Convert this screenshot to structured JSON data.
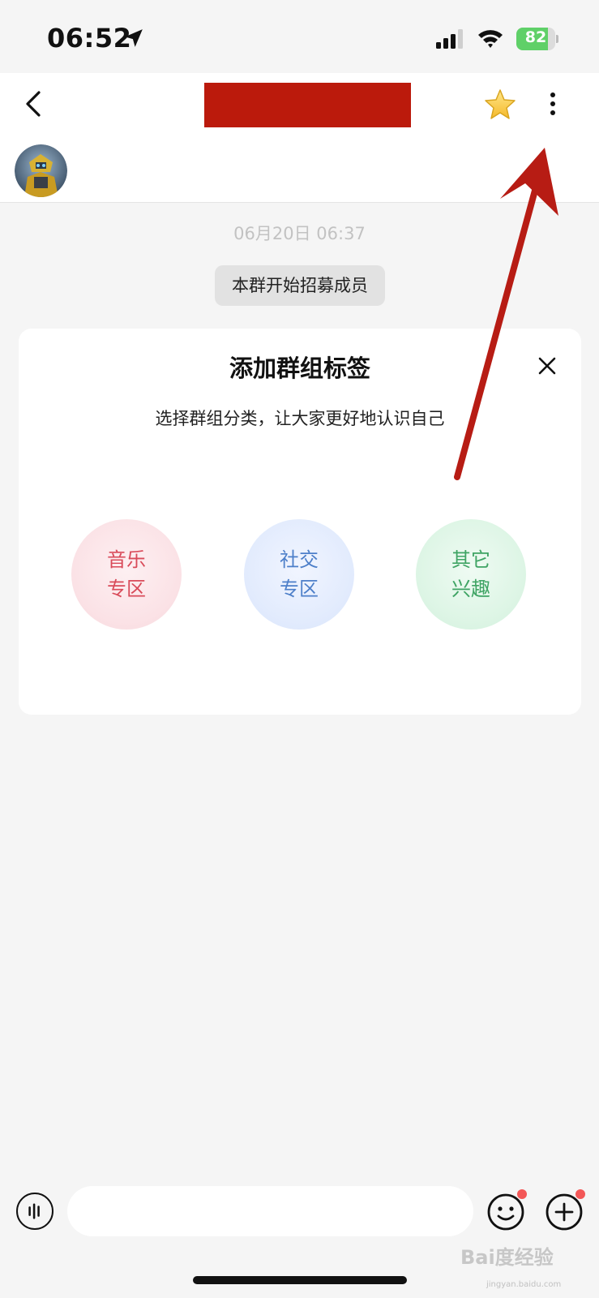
{
  "status_bar": {
    "time": "06:52",
    "battery": "82",
    "battery_level": 0.82
  },
  "chat": {
    "timestamp": "06月20日 06:37",
    "system_message": "本群开始招募成员"
  },
  "tag_card": {
    "title": "添加群组标签",
    "subtitle": "选择群组分类，让大家更好地认识自己",
    "options": [
      {
        "line1": "音乐",
        "line2": "专区"
      },
      {
        "line1": "社交",
        "line2": "专区"
      },
      {
        "line1": "其它",
        "line2": "兴趣"
      }
    ]
  },
  "input": {
    "placeholder": ""
  },
  "watermark": {
    "text": "Bai度经验",
    "sub": "jingyan.baidu.com"
  },
  "colors": {
    "redaction": "#bb1a0c",
    "arrow": "#b71c14",
    "music": "#d94b5a",
    "social": "#4d7fc9",
    "other": "#3fa464"
  },
  "icons": [
    "location-arrow-icon",
    "signal-icon",
    "wifi-icon",
    "back-icon",
    "star-icon",
    "more-vertical-icon",
    "close-icon",
    "voice-icon",
    "emoji-icon",
    "plus-icon"
  ]
}
